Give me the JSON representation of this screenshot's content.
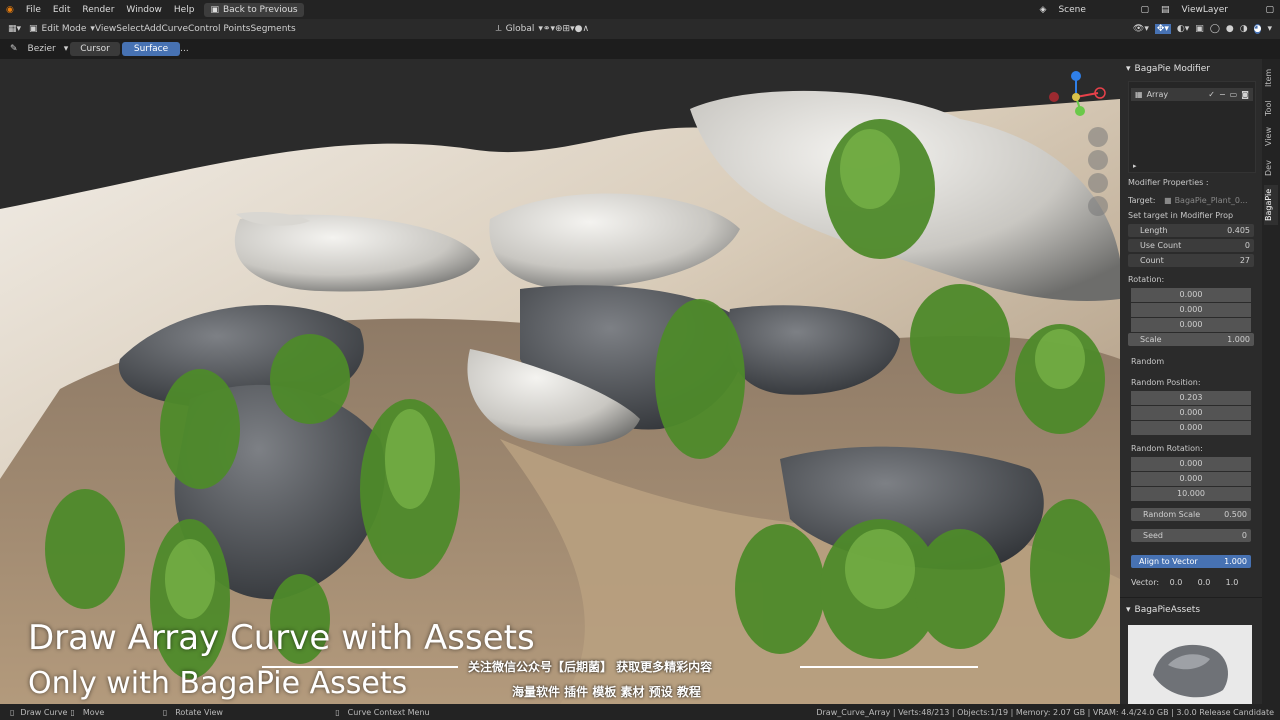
{
  "menu": {
    "items": [
      "File",
      "Edit",
      "Render",
      "Window",
      "Help"
    ],
    "back_label": "Back to Previous",
    "scene_label": "Scene",
    "viewlayer_label": "ViewLayer"
  },
  "header": {
    "mode": "Edit Mode",
    "menus": [
      "View",
      "Select",
      "Add",
      "Curve",
      "Control Points",
      "Segments"
    ],
    "transform_orientation": "Global"
  },
  "tool_header": {
    "curve_type": "Bezier",
    "cursor_label": "Cursor",
    "surface_label": "Surface",
    "more_label": "..."
  },
  "panel": {
    "title": "BagaPie Modifier",
    "list_item": "Array",
    "modifier_props_label": "Modifier Properties :",
    "target_label": "Target:",
    "target_value": "BagaPie_Plant_0...",
    "set_target_note": "Set target in Modifier Prop",
    "length_label": "Length",
    "length_value": "0.405",
    "use_count_label": "Use Count",
    "use_count_value": "0",
    "count_label": "Count",
    "count_value": "27",
    "rotation_label": "Rotation:",
    "rotation_values": [
      "0.000",
      "0.000",
      "0.000"
    ],
    "scale_label": "Scale",
    "scale_value": "1.000",
    "random_label": "Random",
    "random_position_label": "Random Position:",
    "random_position_values": [
      "0.203",
      "0.000",
      "0.000"
    ],
    "random_rotation_label": "Random Rotation:",
    "random_rotation_values": [
      "0.000",
      "0.000",
      "10.000"
    ],
    "random_scale_label": "Random Scale",
    "random_scale_value": "0.500",
    "seed_label": "Seed",
    "seed_value": "0",
    "align_label": "Align to Vector",
    "align_value": "1.000",
    "vector_label": "Vector:",
    "vector_values": [
      "0.0",
      "0.0",
      "1.0"
    ],
    "assets_title": "BagaPieAssets"
  },
  "side_tabs": [
    "Item",
    "Tool",
    "View",
    "Dev",
    "BagaPie"
  ],
  "captions": {
    "line1": "Draw Array Curve with Assets",
    "line2": "Only with BagaPie Assets",
    "cn1": "关注微信公众号【后期菌】 获取更多精彩内容",
    "cn2": "海量软件 插件 模板 素材 预设 教程"
  },
  "status": {
    "draw_curve": "Draw Curve",
    "move": "Move",
    "rotate_view": "Rotate View",
    "context_menu": "Curve Context Menu",
    "stats": "Draw_Curve_Array | Verts:48/213 | Objects:1/19 | Memory: 2.07 GB | VRAM: 4.4/24.0 GB | 3.0.0 Release Candidate"
  },
  "colors": {
    "accent": "#4772b3",
    "sand": "#b9a48a",
    "rock": "#e8e6e2",
    "plant": "#4f8a2c"
  }
}
